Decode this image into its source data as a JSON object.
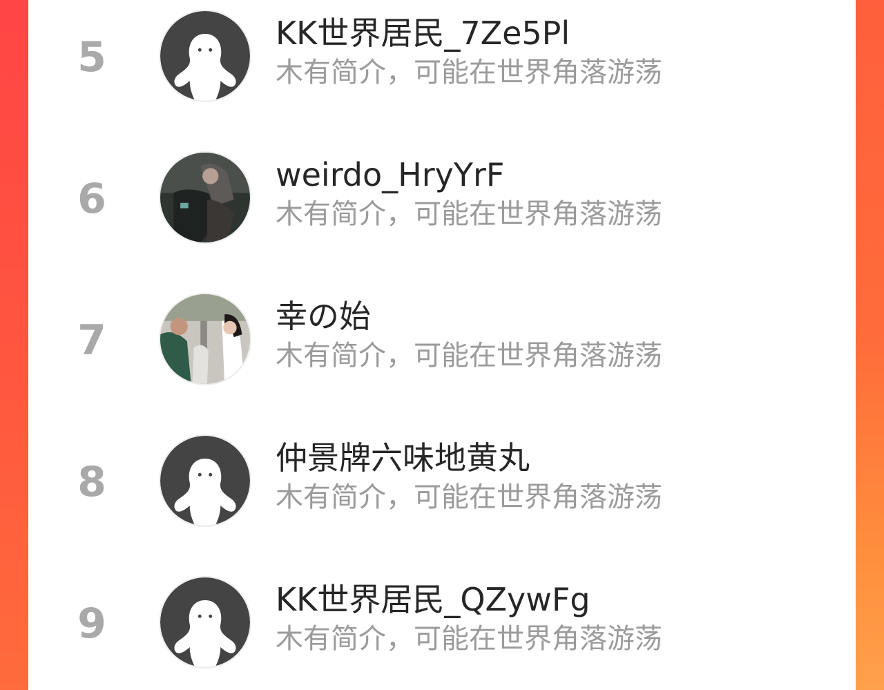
{
  "colors": {
    "accent_left": "#ff4545",
    "accent_right": "#ff8e3d",
    "panel_bg": "#ffffff",
    "rank_text": "#a9a9a9",
    "name_text": "#262626",
    "desc_text": "#9b9b9b",
    "default_avatar": "#444444"
  },
  "ranking": {
    "items": [
      {
        "rank": "5",
        "name": "KK世界居民_7Ze5Pl",
        "description": "木有简介，可能在世界角落游荡",
        "avatar": "default-avatar-icon"
      },
      {
        "rank": "6",
        "name": "weirdo_HryYrF",
        "description": "木有简介，可能在世界角落游荡",
        "avatar": "photo-avatar-dark"
      },
      {
        "rank": "7",
        "name": "幸の始",
        "description": "木有简介，可能在世界角落游荡",
        "avatar": "photo-avatar-couple"
      },
      {
        "rank": "8",
        "name": "仲景牌六味地黄丸",
        "description": "木有简介，可能在世界角落游荡",
        "avatar": "default-avatar-icon"
      },
      {
        "rank": "9",
        "name": "KK世界居民_QZywFg",
        "description": "木有简介，可能在世界角落游荡",
        "avatar": "default-avatar-icon"
      }
    ]
  }
}
